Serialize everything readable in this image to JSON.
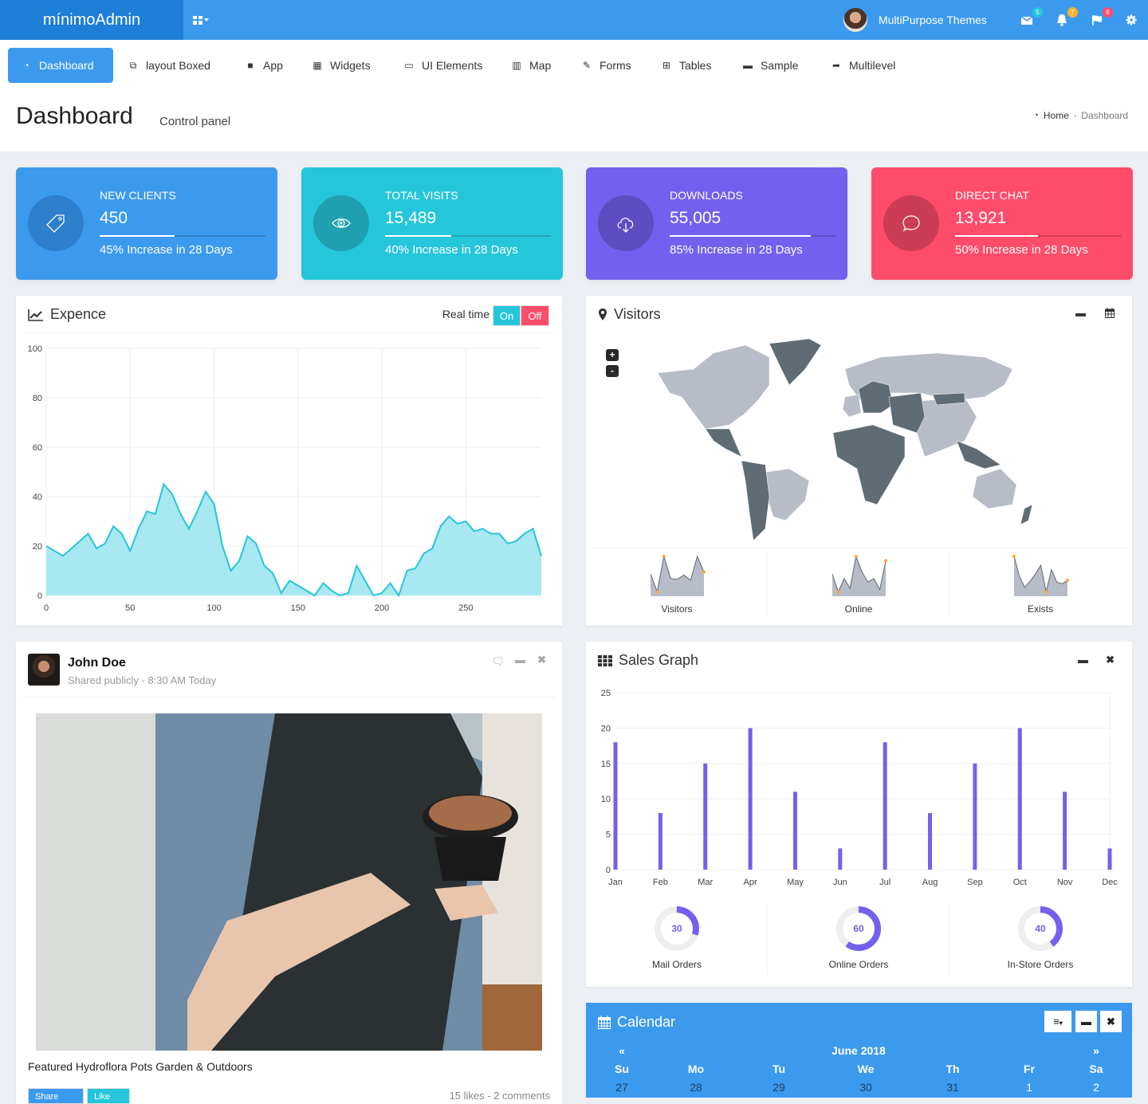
{
  "topbar": {
    "logo": "mínimoAdmin",
    "user_name": "MultiPurpose Themes",
    "badges": {
      "messages": "5",
      "notifications": "7",
      "flags": "6"
    },
    "colors": {
      "primary": "#3c9aee",
      "logo_bg": "#1e7fd8",
      "badge_messages": "#26c6da",
      "badge_notifications": "#ffb22b",
      "badge_flags": "#ff4c6a"
    }
  },
  "menu": {
    "items": [
      {
        "label": "Dashboard",
        "icon": "dashboard-icon",
        "active": true
      },
      {
        "label": "layout Boxed",
        "icon": "copy-icon"
      },
      {
        "label": "App",
        "icon": "archive-icon"
      },
      {
        "label": "Widgets",
        "icon": "grid-icon"
      },
      {
        "label": "UI Elements",
        "icon": "laptop-icon"
      },
      {
        "label": "Map",
        "icon": "map-icon"
      },
      {
        "label": "Forms",
        "icon": "edit-icon"
      },
      {
        "label": "Tables",
        "icon": "table-icon"
      },
      {
        "label": "Sample",
        "icon": "folder-icon"
      },
      {
        "label": "Multilevel",
        "icon": "share-icon"
      }
    ]
  },
  "header": {
    "title": "Dashboard",
    "subtitle": "Control panel",
    "breadcrumb": {
      "home": "Home",
      "current": "Dashboard"
    }
  },
  "stats": [
    {
      "label": "NEW CLIENTS",
      "value": "450",
      "progress_pct": 45,
      "desc": "45% Increase in 28 Days",
      "icon": "tag-icon",
      "color": "#3c9aee",
      "icon_bg": "#2e7fcc"
    },
    {
      "label": "TOTAL VISITS",
      "value": "15,489",
      "progress_pct": 40,
      "desc": "40% Increase in 28 Days",
      "icon": "eye-icon",
      "color": "#26c6da",
      "icon_bg": "#1f9fb0"
    },
    {
      "label": "DOWNLOADS",
      "value": "55,005",
      "progress_pct": 85,
      "desc": "85% Increase in 28 Days",
      "icon": "cloud-download-icon",
      "color": "#7460ee",
      "icon_bg": "#5e4cc2"
    },
    {
      "label": "DIRECT CHAT",
      "value": "13,921",
      "progress_pct": 50,
      "desc": "50% Increase in 28 Days",
      "icon": "chat-icon",
      "color": "#ff4c6a",
      "icon_bg": "#cc3c55"
    }
  ],
  "expense": {
    "title": "Expence",
    "realtime_label": "Real time",
    "on_label": "On",
    "off_label": "Off"
  },
  "visitors": {
    "title": "Visitors",
    "zoom_in": "+",
    "zoom_out": "-",
    "sparklines": [
      {
        "label": "Visitors",
        "values": [
          5,
          1,
          9,
          4,
          3.8,
          4.8,
          3.6,
          9,
          5.5
        ]
      },
      {
        "label": "Online",
        "values": [
          5,
          1,
          4,
          1.8,
          9,
          5.5,
          3.2,
          4,
          1.5,
          8
        ]
      },
      {
        "label": "Exists",
        "values": [
          9,
          4.5,
          2,
          3.4,
          5,
          7,
          1,
          6,
          3.2,
          2.8,
          3.6
        ]
      }
    ],
    "map_colors": {
      "dark": "#606c74",
      "light": "#b7bcc6"
    }
  },
  "post": {
    "author": "John Doe",
    "meta": "Shared publicly - 8:30 AM Today",
    "caption": "Featured Hydroflora Pots Garden & Outdoors",
    "share_label": "Share",
    "like_label": "Like",
    "stats": "15 likes - 2 comments"
  },
  "sales": {
    "title": "Sales Graph",
    "donuts": [
      {
        "label": "Mail Orders",
        "value": 30
      },
      {
        "label": "Online Orders",
        "value": 60
      },
      {
        "label": "In-Store Orders",
        "value": 40
      }
    ]
  },
  "calendar": {
    "title": "Calendar",
    "month": "June 2018",
    "prev": "«",
    "next": "»",
    "weekdays": [
      "Su",
      "Mo",
      "Tu",
      "We",
      "Th",
      "Fr",
      "Sa"
    ],
    "first_row": [
      "27",
      "28",
      "29",
      "30",
      "31",
      "1",
      "2"
    ]
  },
  "chart_data": [
    {
      "type": "area",
      "title": "Expence",
      "xlabel": "",
      "ylabel": "",
      "xlim": [
        0,
        295
      ],
      "ylim": [
        0,
        100
      ],
      "x_ticks": [
        0,
        50,
        100,
        150,
        200,
        250
      ],
      "y_ticks": [
        0,
        20,
        40,
        60,
        80,
        100
      ],
      "grid": true,
      "x": [
        0,
        5,
        10,
        15,
        20,
        25,
        30,
        35,
        40,
        45,
        50,
        55,
        60,
        65,
        70,
        75,
        80,
        85,
        90,
        95,
        100,
        105,
        110,
        115,
        120,
        125,
        130,
        135,
        140,
        145,
        150,
        155,
        160,
        165,
        170,
        175,
        180,
        185,
        190,
        195,
        200,
        205,
        210,
        215,
        220,
        225,
        230,
        235,
        240,
        245,
        250,
        255,
        260,
        265,
        270,
        275,
        280,
        285,
        290,
        295
      ],
      "values": [
        20,
        18,
        16,
        19,
        22,
        25,
        19,
        21,
        28,
        25,
        18,
        27,
        34,
        33,
        45,
        41,
        33,
        27,
        34,
        42,
        37,
        20,
        10,
        14,
        24,
        21,
        12,
        9,
        1,
        6,
        4,
        2,
        0,
        5,
        2,
        0,
        1,
        12,
        6,
        0,
        1,
        5,
        0,
        10,
        11,
        17,
        19,
        28,
        32,
        29,
        30,
        26,
        27,
        25,
        25,
        21,
        22,
        25,
        27,
        16
      ],
      "color": "#26c6da"
    },
    {
      "type": "bar",
      "title": "Sales Graph",
      "categories": [
        "Jan",
        "Feb",
        "Mar",
        "Apr",
        "May",
        "Jun",
        "Jul",
        "Aug",
        "Sep",
        "Oct",
        "Nov",
        "Dec"
      ],
      "values": [
        18,
        8,
        15,
        20,
        11,
        3,
        18,
        8,
        15,
        20,
        11,
        3
      ],
      "ylim": [
        0,
        25
      ],
      "y_ticks": [
        0,
        5,
        10,
        15,
        20,
        25
      ],
      "grid": true,
      "color": "#7460ee"
    }
  ]
}
